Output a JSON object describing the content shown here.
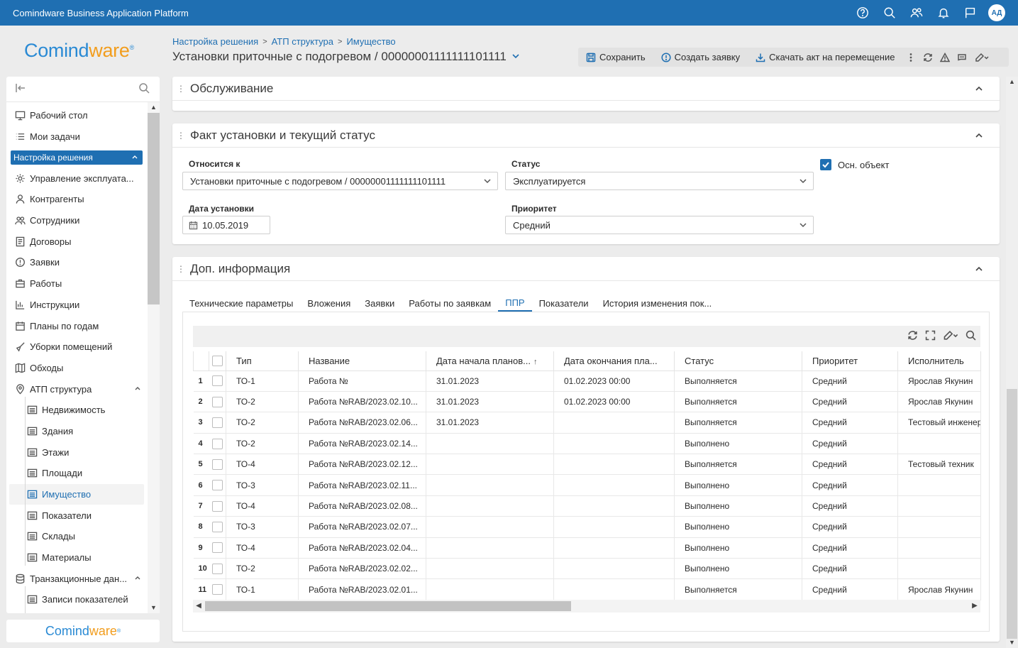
{
  "app": {
    "title": "Comindware Business Application Platform",
    "avatar_initials": "АД",
    "logo_left": "Comind",
    "logo_right": "ware",
    "logo_mark": "®"
  },
  "breadcrumb": {
    "items": [
      "Настройка решения",
      "АТП структура",
      "Имущество"
    ],
    "separator": ">"
  },
  "page": {
    "title": "Установки приточные с подогревом / 00000001111111101111"
  },
  "toolbar": {
    "save_label": "Сохранить",
    "create_request_label": "Создать заявку",
    "download_act_label": "Скачать акт на перемещение"
  },
  "sidebar": {
    "items": [
      {
        "label": "Рабочий стол",
        "icon": "desktop-icon"
      },
      {
        "label": "Мои задачи",
        "icon": "tasks-icon"
      },
      {
        "label": "Настройка решения",
        "icon": "",
        "type": "section"
      },
      {
        "label": "Управление эксплуата...",
        "icon": "settings-group-icon"
      },
      {
        "label": "Контрагенты",
        "icon": "contractors-icon"
      },
      {
        "label": "Сотрудники",
        "icon": "employees-icon"
      },
      {
        "label": "Договоры",
        "icon": "contracts-icon"
      },
      {
        "label": "Заявки",
        "icon": "requests-icon"
      },
      {
        "label": "Работы",
        "icon": "works-icon"
      },
      {
        "label": "Инструкции",
        "icon": "instructions-icon"
      },
      {
        "label": "Планы по годам",
        "icon": "plans-icon"
      },
      {
        "label": "Уборки помещений",
        "icon": "cleaning-icon"
      },
      {
        "label": "Обходы",
        "icon": "rounds-icon"
      },
      {
        "label": "АТП структура",
        "icon": "location-icon"
      },
      {
        "label": "Недвижимость",
        "icon": "list-icon",
        "type": "sub"
      },
      {
        "label": "Здания",
        "icon": "list-icon",
        "type": "sub"
      },
      {
        "label": "Этажи",
        "icon": "list-icon",
        "type": "sub"
      },
      {
        "label": "Площади",
        "icon": "list-icon",
        "type": "sub"
      },
      {
        "label": "Имущество",
        "icon": "list-icon",
        "type": "sub-selected"
      },
      {
        "label": "Показатели",
        "icon": "list-icon",
        "type": "sub"
      },
      {
        "label": "Склады",
        "icon": "list-icon",
        "type": "sub"
      },
      {
        "label": "Материалы",
        "icon": "list-icon",
        "type": "sub"
      },
      {
        "label": "Транзакционные дан...",
        "icon": "transactions-icon"
      },
      {
        "label": "Записи показателей",
        "icon": "list-icon",
        "type": "sub"
      }
    ]
  },
  "panels": {
    "service": {
      "title": "Обслуживание"
    },
    "fact": {
      "title": "Факт установки и текущий статус",
      "relates_label": "Относится к",
      "relates_value": "Установки приточные с подогревом / 00000001111111101111",
      "status_label": "Статус",
      "status_value": "Эксплуатируется",
      "main_object_label": "Осн. объект",
      "install_date_label": "Дата установки",
      "install_date_value": "10.05.2019",
      "priority_label": "Приоритет",
      "priority_value": "Средний"
    },
    "extra": {
      "title": "Доп. информация",
      "tabs": [
        "Технические параметры",
        "Вложения",
        "Заявки",
        "Работы по заявкам",
        "ППР",
        "Показатели",
        "История изменения пок..."
      ],
      "active_tab": 4
    }
  },
  "grid": {
    "columns": [
      "Тип",
      "Название",
      "Дата начала планов...",
      "Дата окончания пла...",
      "Статус",
      "Приоритет",
      "Исполнитель"
    ],
    "rows": [
      {
        "n": "1",
        "type": "ТО-1",
        "name": "Работа №",
        "start": "31.01.2023",
        "end": "01.02.2023 00:00",
        "status": "Выполняется",
        "priority": "Средний",
        "executor": "Ярослав Якунин"
      },
      {
        "n": "2",
        "type": "ТО-2",
        "name": "Работа №RAB/2023.02.10...",
        "start": "31.01.2023",
        "end": "01.02.2023 00:00",
        "status": "Выполняется",
        "priority": "Средний",
        "executor": "Ярослав Якунин"
      },
      {
        "n": "3",
        "type": "ТО-2",
        "name": "Работа №RAB/2023.02.06...",
        "start": "31.01.2023",
        "end": "",
        "status": "Выполняется",
        "priority": "Средний",
        "executor": "Тестовый инженер"
      },
      {
        "n": "4",
        "type": "ТО-2",
        "name": "Работа №RAB/2023.02.14...",
        "start": "",
        "end": "",
        "status": "Выполнено",
        "priority": "Средний",
        "executor": ""
      },
      {
        "n": "5",
        "type": "ТО-4",
        "name": "Работа №RAB/2023.02.12...",
        "start": "",
        "end": "",
        "status": "Выполняется",
        "priority": "Средний",
        "executor": "Тестовый техник"
      },
      {
        "n": "6",
        "type": "ТО-3",
        "name": "Работа №RAB/2023.02.11...",
        "start": "",
        "end": "",
        "status": "Выполнено",
        "priority": "Средний",
        "executor": ""
      },
      {
        "n": "7",
        "type": "ТО-4",
        "name": "Работа №RAB/2023.02.08...",
        "start": "",
        "end": "",
        "status": "Выполнено",
        "priority": "Средний",
        "executor": ""
      },
      {
        "n": "8",
        "type": "ТО-3",
        "name": "Работа №RAB/2023.02.07...",
        "start": "",
        "end": "",
        "status": "Выполнено",
        "priority": "Средний",
        "executor": ""
      },
      {
        "n": "9",
        "type": "ТО-4",
        "name": "Работа №RAB/2023.02.04...",
        "start": "",
        "end": "",
        "status": "Выполнено",
        "priority": "Средний",
        "executor": ""
      },
      {
        "n": "10",
        "type": "ТО-2",
        "name": "Работа №RAB/2023.02.02...",
        "start": "",
        "end": "",
        "status": "Выполнено",
        "priority": "Средний",
        "executor": ""
      },
      {
        "n": "11",
        "type": "ТО-1",
        "name": "Работа №RAB/2023.02.01...",
        "start": "",
        "end": "",
        "status": "Выполняется",
        "priority": "Средний",
        "executor": "Ярослав Якунин"
      }
    ]
  },
  "colors": {
    "brand_blue": "#1f6fb2",
    "logo_blue": "#2a8ad4",
    "logo_orange": "#f29d1d"
  }
}
